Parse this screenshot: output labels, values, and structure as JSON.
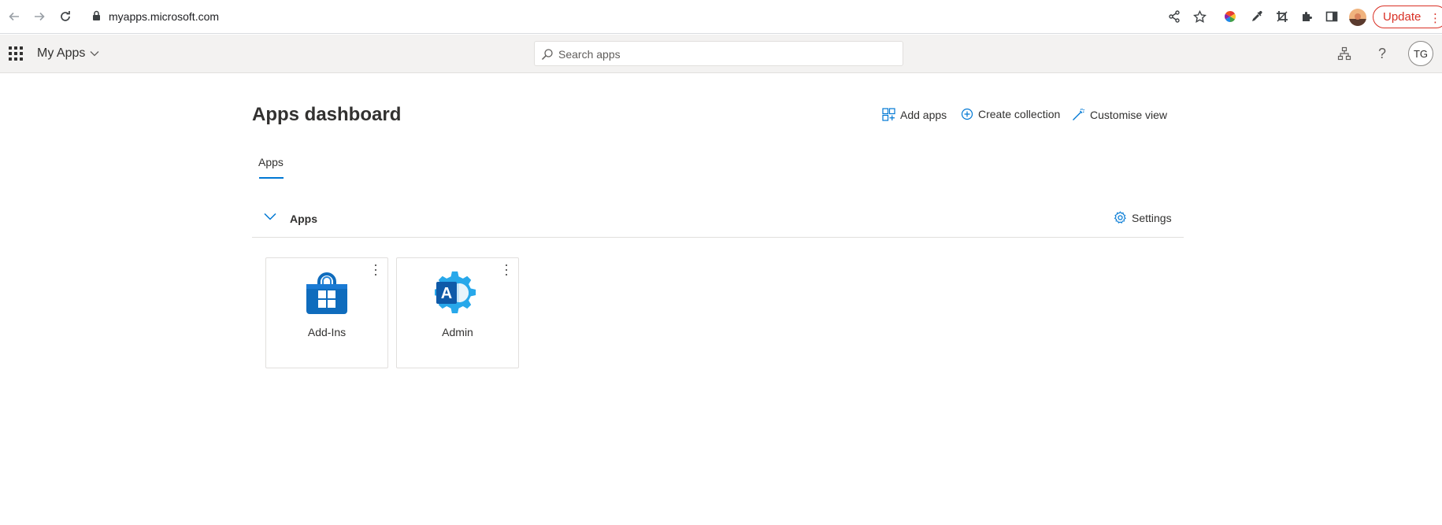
{
  "browser": {
    "url": "myapps.microsoft.com",
    "update_label": "Update"
  },
  "header": {
    "app_title": "My Apps",
    "search_placeholder": "Search apps",
    "avatar_initials": "TG"
  },
  "main": {
    "title": "Apps dashboard",
    "actions": {
      "add_apps": "Add apps",
      "create_collection": "Create collection",
      "customise_view": "Customise view"
    },
    "tabs": [
      {
        "label": "Apps",
        "active": true
      }
    ],
    "section": {
      "title": "Apps",
      "settings_label": "Settings"
    },
    "apps": [
      {
        "label": "Add-Ins",
        "icon": "store-bag-icon"
      },
      {
        "label": "Admin",
        "icon": "admin-gear-icon"
      }
    ]
  },
  "colors": {
    "accent": "#0078d4",
    "update_red": "#d93025",
    "header_bg": "#f3f2f1"
  }
}
